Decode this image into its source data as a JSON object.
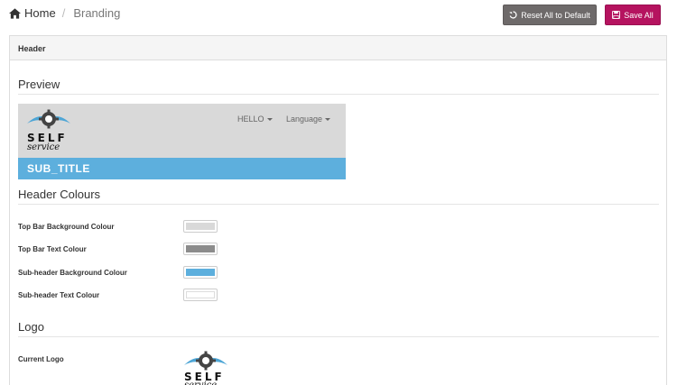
{
  "breadcrumb": {
    "home_label": "Home",
    "current_label": "Branding"
  },
  "toolbar": {
    "reset_label": "Reset All to Default",
    "save_label": "Save All"
  },
  "panel": {
    "heading": "Header"
  },
  "preview": {
    "title": "Preview",
    "nav_user": "HELLO",
    "nav_language": "Language",
    "sub_title": "SUB_TITLE",
    "logo_self": "SELF",
    "logo_service": "service"
  },
  "header_colours": {
    "title": "Header Colours",
    "fields": [
      {
        "label": "Top Bar Background Colour",
        "color": "#d9d9d9"
      },
      {
        "label": "Top Bar Text Colour",
        "color": "#8c8c8c"
      },
      {
        "label": "Sub-header Background Colour",
        "color": "#5dafdd"
      },
      {
        "label": "Sub-header Text Colour",
        "color": "#ffffff"
      }
    ]
  },
  "logo_section": {
    "title": "Logo",
    "current_logo_label": "Current Logo",
    "logo_self": "SELF",
    "logo_service": "service"
  }
}
